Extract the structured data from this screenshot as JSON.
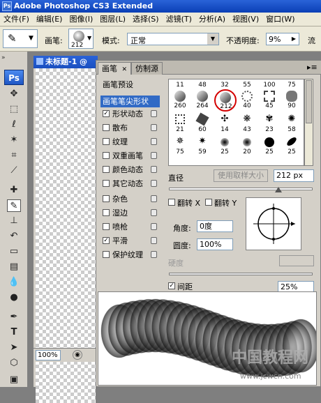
{
  "app_title": "Adobe Photoshop CS3 Extended",
  "menu": [
    "文件(F)",
    "编辑(E)",
    "图像(I)",
    "图层(L)",
    "选择(S)",
    "滤镜(T)",
    "分析(A)",
    "视图(V)",
    "窗口(W)"
  ],
  "options": {
    "brush_label": "画笔:",
    "brush_size": "212",
    "mode_label": "模式:",
    "mode_value": "正常",
    "opacity_label": "不透明度:",
    "opacity_value": "9%",
    "flow_label": "流"
  },
  "document": {
    "title": "未标题-1 @",
    "zoom": "100%"
  },
  "panel": {
    "tabs": [
      "画笔",
      "仿制源"
    ],
    "presets_title": "画笔预设",
    "items": [
      {
        "label": "画笔笔尖形状",
        "checked": null,
        "selected": true
      },
      {
        "label": "形状动态",
        "checked": true
      },
      {
        "label": "散布",
        "checked": false
      },
      {
        "label": "纹理",
        "checked": false
      },
      {
        "label": "双重画笔",
        "checked": false
      },
      {
        "label": "颜色动态",
        "checked": false
      },
      {
        "label": "其它动态",
        "checked": false
      },
      {
        "label": "杂色",
        "checked": false
      },
      {
        "label": "湿边",
        "checked": false
      },
      {
        "label": "喷枪",
        "checked": false
      },
      {
        "label": "平滑",
        "checked": true
      },
      {
        "label": "保护纹理",
        "checked": false
      }
    ],
    "brush_row_top": [
      "11",
      "48",
      "32",
      "55",
      "100",
      "75"
    ],
    "brush_sizes": [
      "260",
      "264",
      "212",
      "40",
      "45",
      "90",
      "21",
      "60",
      "14",
      "43",
      "23",
      "58",
      "75",
      "59",
      "25",
      "20",
      "25",
      "25"
    ],
    "diameter_label": "直径",
    "sample_button": "使用取样大小",
    "diameter_value": "212 px",
    "flip_x": "翻转 X",
    "flip_y": "翻转 Y",
    "angle_label": "角度:",
    "angle_value": "0度",
    "roundness_label": "圆度:",
    "roundness_value": "100%",
    "hardness_label": "硬度",
    "spacing_label": "间距",
    "spacing_value": "25%"
  },
  "watermark": "中国教程网",
  "watermark_url": "www.jcwcn.com"
}
